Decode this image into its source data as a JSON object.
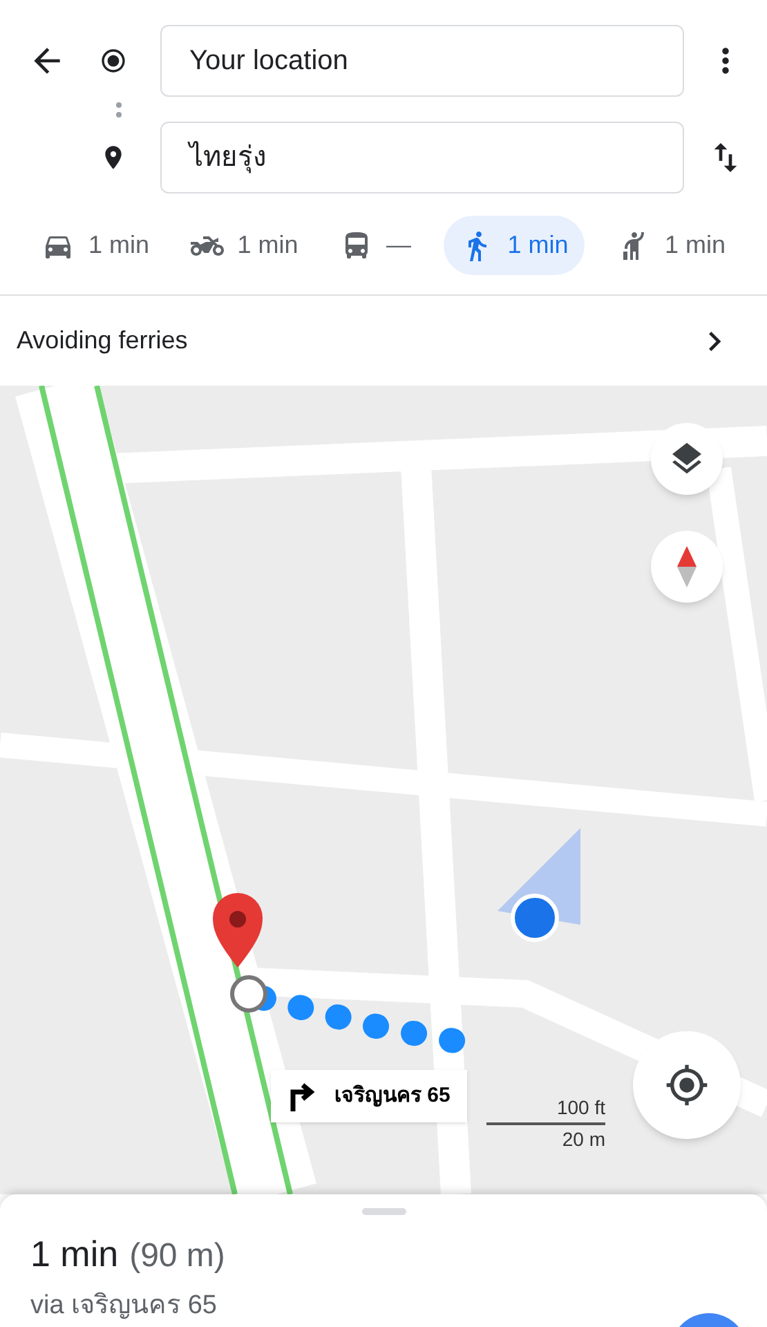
{
  "origin": {
    "value": "Your location"
  },
  "destination": {
    "value": "ไทยรุ่ง"
  },
  "modes": [
    {
      "kind": "car",
      "time": "1 min",
      "selected": false
    },
    {
      "kind": "motorcycle",
      "time": "1 min",
      "selected": false
    },
    {
      "kind": "transit",
      "time": "—",
      "selected": false
    },
    {
      "kind": "walk",
      "time": "1 min",
      "selected": true
    },
    {
      "kind": "ride",
      "time": "1 min",
      "selected": false
    }
  ],
  "options": {
    "label": "Avoiding ferries"
  },
  "map": {
    "kind": "picture",
    "turn_label": "เจริญนคร 65",
    "scale_imperial": "100 ft",
    "scale_metric": "20 m"
  },
  "sheet": {
    "duration": "1 min",
    "distance": "(90 m)",
    "via": "via เจริญนคร 65"
  }
}
